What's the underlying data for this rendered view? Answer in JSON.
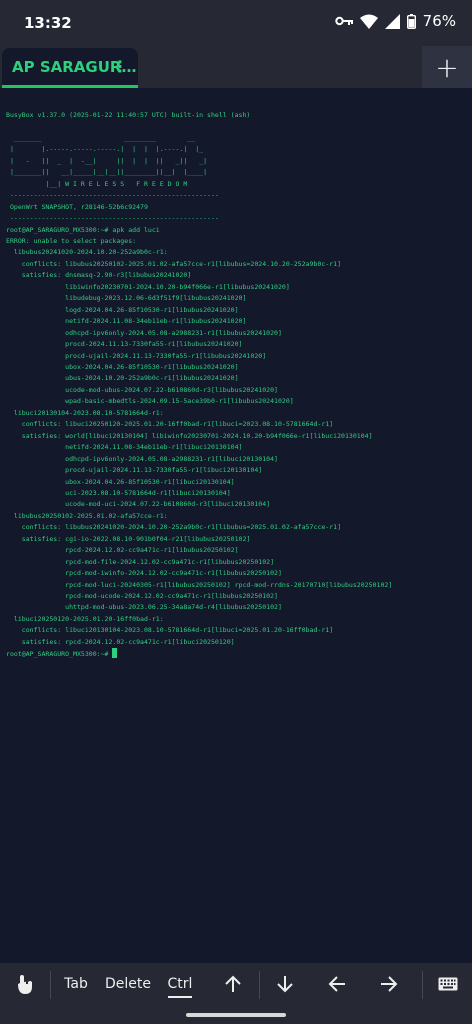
{
  "status": {
    "time": "13:32",
    "battery": "76%"
  },
  "tab": {
    "title": "AP SARAGUR…",
    "menu_icon": "more-vert-icon",
    "new_tab_label": "+"
  },
  "terminal": {
    "text": "BusyBox v1.37.0 (2025-01-22 11:40:57 UTC) built-in shell (ash)\n\n  _______                     ________        __\n |       |.-----.-----.-----.|  |  |  |.----.|  |_\n |   -   ||  _  |  -__|     ||  |  |  ||   _||   _|\n |_______||   __|_____|__|__||________||__|  |____|\n          |__| W I R E L E S S   F R E E D O M\n -----------------------------------------------------\n OpenWrt SNAPSHOT, r28146-52b6c92479\n -----------------------------------------------------\nroot@AP_SARAGURO_MX5300:~# apk add luci\nERROR: unable to select packages:\n  libubus20241020-2024.10.20-252a9b0c-r1:\n    conflicts: libubus20250102-2025.01.02-afa57cce-r1[libubus=2024.10.20-252a9b0c-r1]\n    satisfies: dnsmasq-2.90-r3[libubus20241020]\n               libiwinfo20230701-2024.10.20-b94f066e-r1[libubus20241020]\n               libudebug-2023.12.06-6d3f51f9[libubus20241020]\n               logd-2024.04.26-85f10530-r1[libubus20241020]\n               netifd-2024.11.08-34eb11eb-r1[libubus20241020]\n               odhcpd-ipv6only-2024.05.08-a2988231-r1[libubus20241020]\n               procd-2024.11.13-7330fa55-r1[libubus20241020]\n               procd-ujail-2024.11.13-7330fa55-r1[libubus20241020]\n               ubox-2024.04.26-85f10530-r1[libubus20241020]\n               ubus-2024.10.20-252a9b0c-r1[libubus20241020]\n               ucode-mod-ubus-2024.07.22-b610860d-r3[libubus20241020]\n               wpad-basic-mbedtls-2024.09.15-5ace39b0-r1[libubus20241020]\n  libuci20130104-2023.08.10-5781664d-r1:\n    conflicts: libuci20250120-2025.01.20-16ff0bad-r1[libuci=2023.08.10-5781664d-r1]\n    satisfies: world[libuci20130104] libiwinfo20230701-2024.10.20-b94f066e-r1[libuci20130104]\n               netifd-2024.11.08-34eb11eb-r1[libuci20130104]\n               odhcpd-ipv6only-2024.05.08-a2988231-r1[libuci20130104]\n               procd-ujail-2024.11.13-7330fa55-r1[libuci20130104]\n               ubox-2024.04.26-85f10530-r1[libuci20130104]\n               uci-2023.08.10-5781664d-r1[libuci20130104]\n               ucode-mod-uci-2024.07.22-b610860d-r3[libuci20130104]\n  libubus20250102-2025.01.02-afa57cce-r1:\n    conflicts: libubus20241020-2024.10.20-252a9b0c-r1[libubus=2025.01.02-afa57cce-r1]\n    satisfies: cgi-io-2022.08.10-901b0f04-r21[libubus20250102]\n               rpcd-2024.12.02-cc9a471c-r1[libubus20250102]\n               rpcd-mod-file-2024.12.02-cc9a471c-r1[libubus20250102]\n               rpcd-mod-iwinfo-2024.12.02-cc9a471c-r1[libubus20250102]\n               rpcd-mod-luci-20240305-r1[libubus20250102] rpcd-mod-rrdns-20170710[libubus20250102]\n               rpcd-mod-ucode-2024.12.02-cc9a471c-r1[libubus20250102]\n               uhttpd-mod-ubus-2023.06.25-34a8a74d-r4[libubus20250102]\n  libuci20250120-2025.01.20-16ff0bad-r1:\n    conflicts: libuci20130104-2023.08.10-5781664d-r1[libuci=2025.01.20-16ff0bad-r1]\n    satisfies: rpcd-2024.12.02-cc9a471c-r1[libuci20250120]\n",
    "prompt": "root@AP_SARAGURO_MX5300:~# "
  },
  "keys": {
    "touch_icon": "touch-gesture-icon",
    "tab": "Tab",
    "delete": "Delete",
    "ctrl": "Ctrl",
    "up_icon": "arrow-up-icon",
    "down_icon": "arrow-down-icon",
    "left_icon": "arrow-left-icon",
    "right_icon": "arrow-right-icon",
    "keyboard_icon": "keyboard-icon"
  },
  "colors": {
    "terminal_bg": "#13182b",
    "terminal_fg": "#2fcf82",
    "bar_bg": "#262833",
    "accent": "#22c55e"
  }
}
